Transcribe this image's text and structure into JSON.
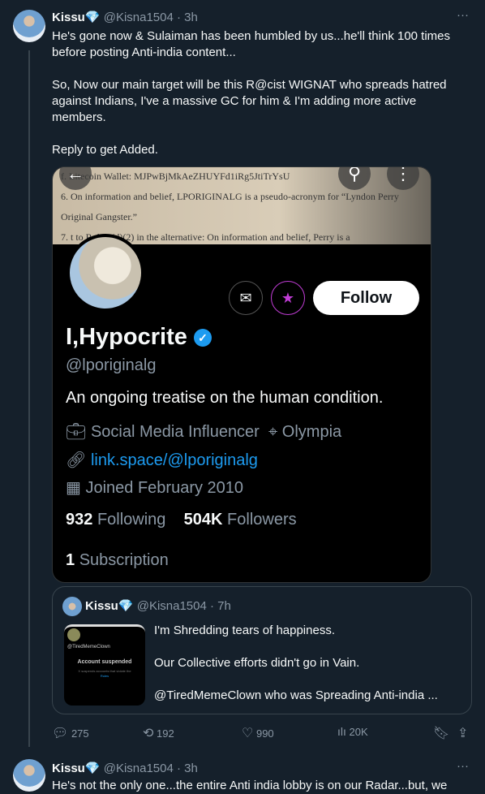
{
  "tweet": {
    "name": "Kissu",
    "badge": "💎",
    "handle": "@Kisna1504",
    "time": "· 3h",
    "more": "···",
    "text": "He's gone now & Sulaiman has been humbled by us...he'll think 100 times before posting Anti-india content...\n\nSo, Now our main target will be this R@cist WIGNAT who spreads hatred against Indians, I've a massive GC for him & I'm adding more active members.\n\nReply to get Added."
  },
  "profile_shot": {
    "banner_lines": [
      "f.        Litecoin Wallet: MJPwBjMkAeZHUYFd1iRg5JtiTrYsU",
      "6.      On information and belief, LPORIGINALG is a pseudo-acronym for “Lyndon Perry",
      "Original Gangster.”",
      "7.         t to Rule 8(d)(2) in the alternative: On information and belief, Perry is a"
    ],
    "follow_label": "Follow",
    "display_name": "I,Hypocrite",
    "handle": "@lporiginalg",
    "bio": "An ongoing treatise on the human condition.",
    "category": "Social Media Influencer",
    "location": "Olympia",
    "link": "link.space/@lporiginalg",
    "joined": "Joined February 2010",
    "following_count": "932",
    "following_label": "Following",
    "followers_count": "504K",
    "followers_label": "Followers",
    "subscription_count": "1",
    "subscription_label": "Subscription",
    "accent": "#1d9bf0",
    "subscribe_color": "#c13dd6"
  },
  "quoted": {
    "name": "Kissu",
    "badge": "💎",
    "handle": "@Kisna1504",
    "time": "· 7h",
    "thumb": {
      "handle": "@TiredMemeClown",
      "title": "Account suspended",
      "sub": "X suspends accounts that violate the",
      "rules": "Rules"
    },
    "lines": [
      "I'm Shredding tears of happiness.",
      "Our Collective efforts didn't go in Vain.",
      "@TiredMemeClown who was Spreading Anti-india ..."
    ]
  },
  "actions": {
    "replies": "275",
    "reposts": "192",
    "likes": "990",
    "views": "20K"
  },
  "next_tweet": {
    "name": "Kissu",
    "badge": "💎",
    "handle": "@Kisna1504",
    "time": "· 3h",
    "more": "···",
    "text": "He's not the only one...the entire Anti india lobby is on our Radar...but, we"
  }
}
